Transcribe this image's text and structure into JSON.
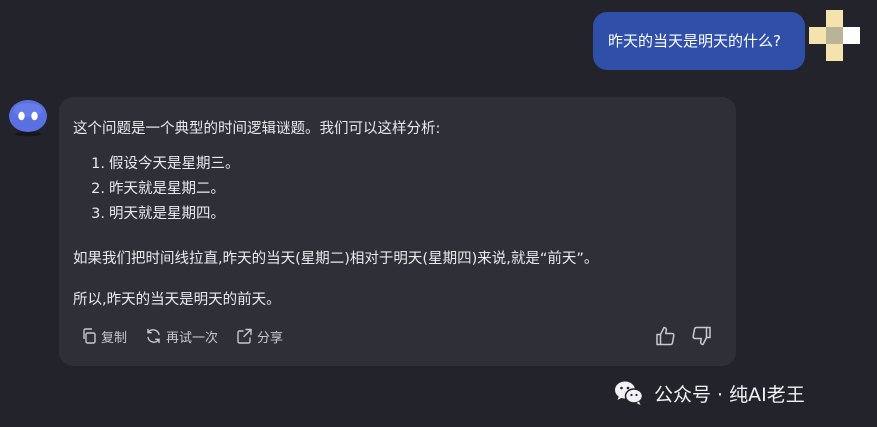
{
  "user_message": {
    "text": "昨天的当天是明天的什么?"
  },
  "assistant_message": {
    "intro": "这个问题是一个典型的时间逻辑谜题。我们可以这样分析:",
    "steps": [
      {
        "number": "1.",
        "text": "假设今天是星期三。"
      },
      {
        "number": "2.",
        "text": "昨天就是星期二。"
      },
      {
        "number": "3.",
        "text": "明天就是星期四。"
      }
    ],
    "explanation": "如果我们把时间线拉直,昨天的当天(星期二)相对于明天(星期四)来说,就是“前天”。",
    "conclusion": "所以,昨天的当天是明天的前天。"
  },
  "actions": {
    "copy_label": "复制",
    "regenerate_label": "再试一次",
    "share_label": "分享"
  },
  "watermark": {
    "text": "公众号 · 纯AI老王"
  },
  "colors": {
    "background": "#23232b",
    "card": "#2f2f38",
    "user_bubble": "#2f4fa8",
    "bot_avatar": "#5a6fe0"
  },
  "icons": [
    "copy-icon",
    "refresh-icon",
    "share-icon",
    "thumbs-up-icon",
    "thumbs-down-icon",
    "wechat-icon"
  ]
}
